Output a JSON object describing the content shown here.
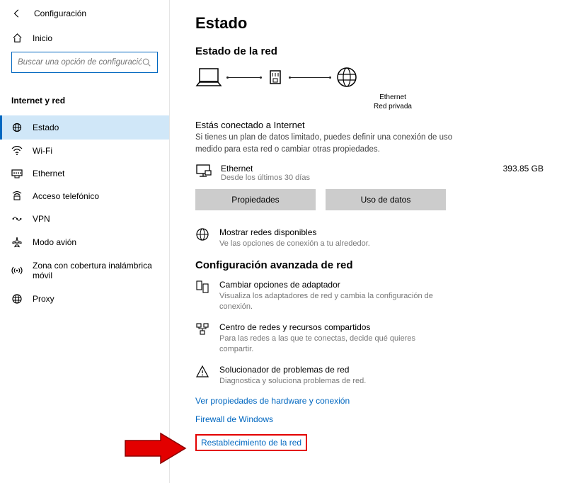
{
  "header": {
    "config_label": "Configuración",
    "home_label": "Inicio"
  },
  "search": {
    "placeholder": "Buscar una opción de configuración"
  },
  "category": "Internet y red",
  "sidebar": {
    "items": [
      {
        "label": "Estado"
      },
      {
        "label": "Wi-Fi"
      },
      {
        "label": "Ethernet"
      },
      {
        "label": "Acceso telefónico"
      },
      {
        "label": "VPN"
      },
      {
        "label": "Modo avión"
      },
      {
        "label": "Zona con cobertura inalámbrica móvil"
      },
      {
        "label": "Proxy"
      }
    ]
  },
  "main": {
    "title": "Estado",
    "net_status_title": "Estado de la red",
    "diagram": {
      "type": "Ethernet",
      "scope": "Red privada"
    },
    "connected_title": "Estás conectado a Internet",
    "connected_desc": "Si tienes un plan de datos limitado, puedes definir una conexión de uso medido para esta red o cambiar otras propiedades.",
    "usage": {
      "name": "Ethernet",
      "period": "Desde los últimos 30 días",
      "value": "393.85 GB"
    },
    "btn_properties": "Propiedades",
    "btn_data_usage": "Uso de datos",
    "show_networks": {
      "title": "Mostrar redes disponibles",
      "desc": "Ve las opciones de conexión a tu alrededor."
    },
    "advanced_title": "Configuración avanzada de red",
    "adv": [
      {
        "title": "Cambiar opciones de adaptador",
        "desc": "Visualiza los adaptadores de red y cambia la configuración de conexión."
      },
      {
        "title": "Centro de redes y recursos compartidos",
        "desc": "Para las redes a las que te conectas, decide qué quieres compartir."
      },
      {
        "title": "Solucionador de problemas de red",
        "desc": "Diagnostica y soluciona problemas de red."
      }
    ],
    "link_hw": "Ver propiedades de hardware y conexión",
    "link_firewall": "Firewall de Windows",
    "link_reset": "Restablecimiento de la red"
  }
}
